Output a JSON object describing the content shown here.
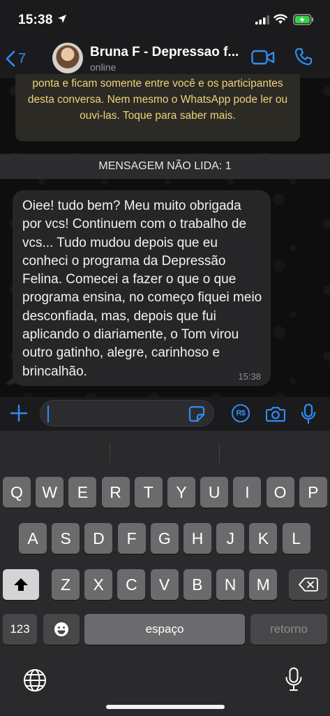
{
  "status": {
    "time": "15:38",
    "battery_color": "#3ad04a"
  },
  "header": {
    "back_count": "7",
    "contact_name": "Bruna F - Depressao f...",
    "contact_status": "online",
    "accent": "#2f8df5"
  },
  "notice": {
    "text": "ponta e ficam somente entre você e os participantes desta conversa. Nem mesmo o WhatsApp pode ler ou ouvi-las. Toque para saber mais."
  },
  "unread_banner": "MENSAGEM NÃO LIDA: 1",
  "message": {
    "text": "Oiee! tudo bem? Meu muito obrigada por vcs! Continuem com o trabalho de vcs... Tudo mudou depois que eu conheci o programa da Depressão Felina. Comecei a fazer o que o que programa ensina, no começo fiquei meio desconfiada, mas, depois que fui aplicando o diariamente, o Tom virou outro gatinho, alegre, carinhoso e brincalhão.",
    "time": "15:38"
  },
  "input": {
    "value": "",
    "pay_label": "R$"
  },
  "keyboard": {
    "row1": [
      "Q",
      "W",
      "E",
      "R",
      "T",
      "Y",
      "U",
      "I",
      "O",
      "P"
    ],
    "row2": [
      "A",
      "S",
      "D",
      "F",
      "G",
      "H",
      "J",
      "K",
      "L"
    ],
    "row3": [
      "Z",
      "X",
      "C",
      "V",
      "B",
      "N",
      "M"
    ],
    "numbers_label": "123",
    "space_label": "espaço",
    "return_label": "retorno"
  }
}
